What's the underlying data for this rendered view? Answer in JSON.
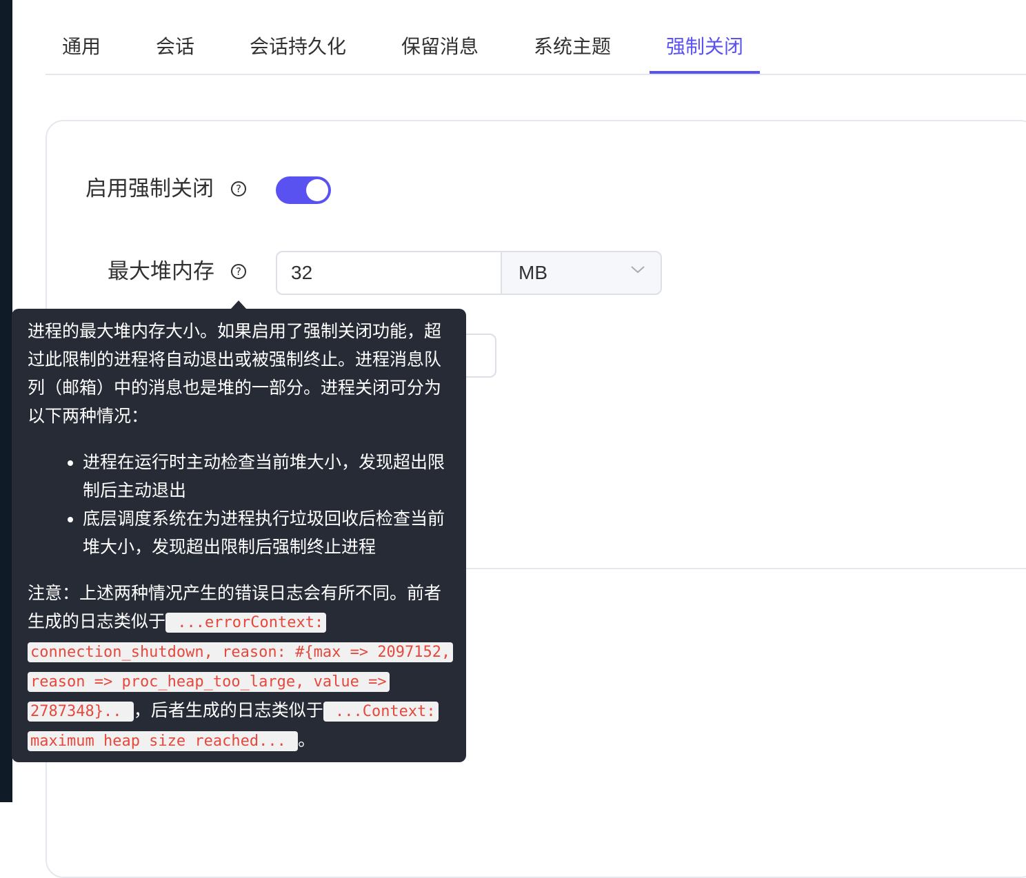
{
  "tabs": [
    {
      "label": "通用"
    },
    {
      "label": "会话"
    },
    {
      "label": "会话持久化"
    },
    {
      "label": "保留消息"
    },
    {
      "label": "系统主题"
    },
    {
      "label": "强制关闭"
    }
  ],
  "active_tab": "强制关闭",
  "form": {
    "enable_label": "启用强制关闭",
    "enable_value": true,
    "heap_label": "最大堆内存",
    "heap_value": "32",
    "heap_unit": "MB"
  },
  "tooltip": {
    "intro": "进程的最大堆内存大小。如果启用了强制关闭功能，超过此限制的进程将自动退出或被强制终止。进程消息队列（邮箱）中的消息也是堆的一部分。进程关闭可分为以下两种情况：",
    "bullets": [
      "进程在运行时主动检查当前堆大小，发现超出限制后主动退出",
      "底层调度系统在为进程执行垃圾回收后检查当前堆大小，发现超出限制后强制终止进程"
    ],
    "note_prefix": "注意：上述两种情况产生的错误日志会有所不同。前者生成的日志类似于",
    "code1": " ...errorContext: connection_shutdown, reason: #{max => 2097152, reason => proc_heap_too_large, value => 2787348}.. ",
    "note_middle": "，后者生成的日志类似于",
    "code2": " ...Context: maximum heap size reached... ",
    "note_suffix": "。"
  },
  "colors": {
    "accent": "#5a52f0",
    "tooltip_bg": "#272b36",
    "code_text": "#e5483c"
  },
  "icons": [
    "question-circle-icon",
    "chevron-down-icon"
  ]
}
